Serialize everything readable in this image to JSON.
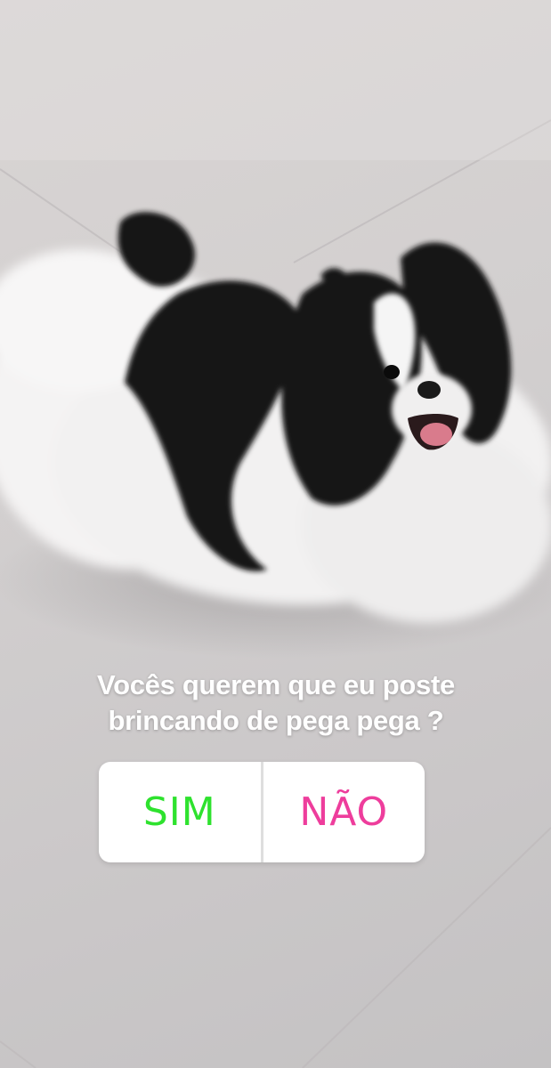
{
  "story": {
    "question": {
      "line1": "Vocês querem que eu poste",
      "line2": "brincando de pega pega ?"
    },
    "poll": {
      "options": [
        {
          "label": "SIM",
          "color": "#2ee22e"
        },
        {
          "label": "NÃO",
          "color": "#ee3d9c"
        }
      ]
    }
  }
}
